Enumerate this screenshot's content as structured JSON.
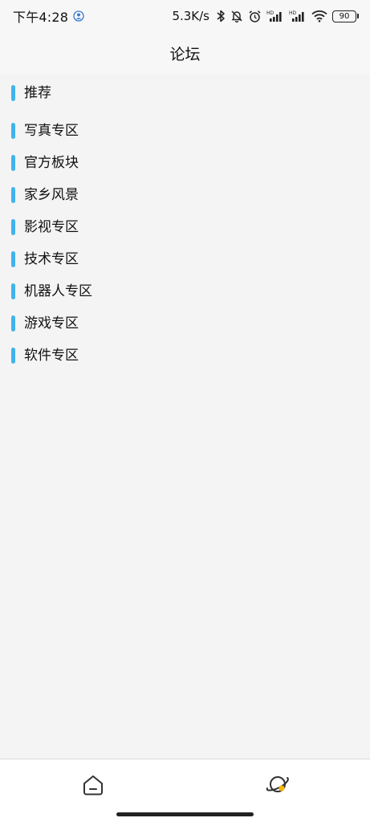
{
  "status_bar": {
    "time": "下午4:28",
    "net_speed": "5.3K/s",
    "battery": "90",
    "icons": [
      "profile-sync-icon",
      "bluetooth-icon",
      "mute-bell-icon",
      "alarm-icon",
      "hd-signal-icon",
      "hd-signal-icon",
      "wifi-icon",
      "battery-icon"
    ]
  },
  "header": {
    "title": "论坛"
  },
  "categories": [
    {
      "label": "推荐"
    },
    {
      "label": "写真专区"
    },
    {
      "label": "官方板块"
    },
    {
      "label": "家乡风景"
    },
    {
      "label": "影视专区"
    },
    {
      "label": "技术专区"
    },
    {
      "label": "机器人专区"
    },
    {
      "label": "游戏专区"
    },
    {
      "label": "软件专区"
    }
  ],
  "colors": {
    "accent_bar": "#41b4ec",
    "forum_icon_accent": "#f5b800",
    "background": "#f4f4f5"
  },
  "bottom_nav": {
    "items": [
      {
        "icon": "home-icon"
      },
      {
        "icon": "planet-icon",
        "active": true
      }
    ]
  }
}
